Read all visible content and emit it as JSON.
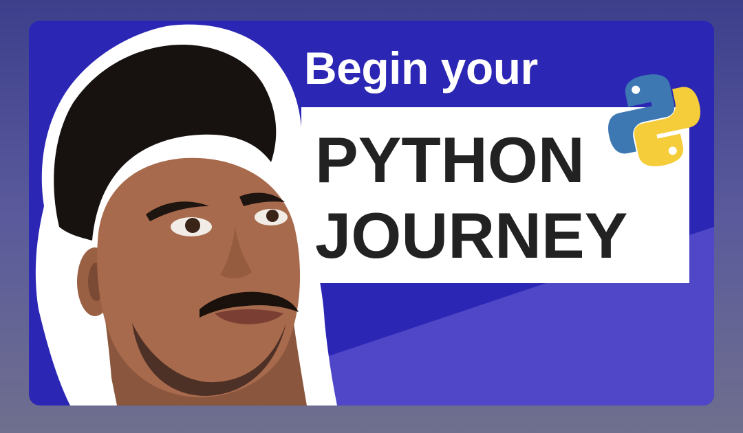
{
  "thumbnail": {
    "headline_small": "Begin your",
    "title_line_1": "PYTHON",
    "title_line_2": "JOURNEY"
  },
  "colors": {
    "page_background": "#4a4a96",
    "card_background": "#2b26b3",
    "diagonal_stripe": "#4f46c8",
    "title_box": "#ffffff",
    "title_text": "#222222",
    "python_blue": "#3d78b3",
    "python_yellow": "#f5cd3b"
  },
  "icons": {
    "logo": "python-logo-icon"
  }
}
